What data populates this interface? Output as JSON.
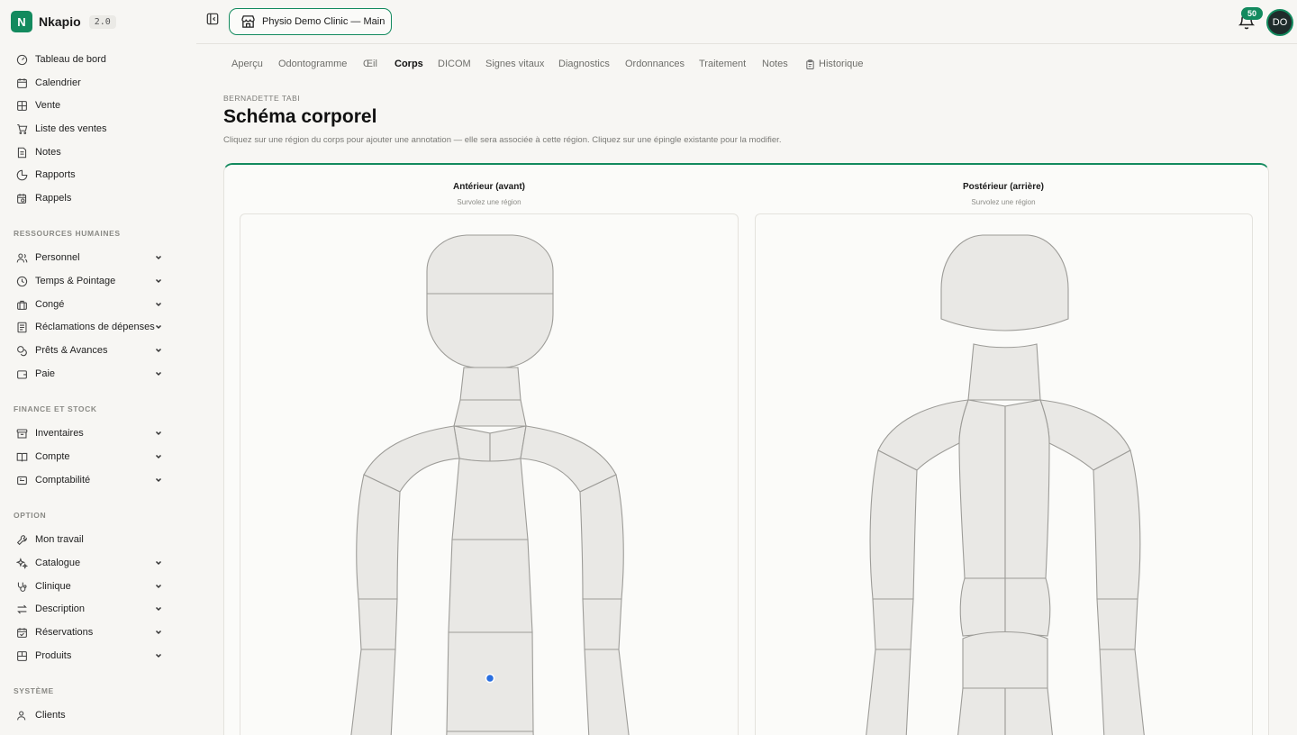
{
  "brand": {
    "logo_letter": "N",
    "name": "Nkapio",
    "version": "2.0"
  },
  "sidebar": {
    "main_items": [
      {
        "label": "Tableau de bord",
        "icon": "dashboard-icon"
      },
      {
        "label": "Calendrier",
        "icon": "calendar-icon"
      },
      {
        "label": "Vente",
        "icon": "grid-icon"
      },
      {
        "label": "Liste des ventes",
        "icon": "cart-icon"
      },
      {
        "label": "Notes",
        "icon": "note-icon"
      },
      {
        "label": "Rapports",
        "icon": "pie-chart-icon"
      },
      {
        "label": "Rappels",
        "icon": "calendar-clock-icon"
      }
    ],
    "sections": [
      {
        "label": "RESSOURCES HUMAINES",
        "items": [
          {
            "label": "Personnel",
            "icon": "users-icon"
          },
          {
            "label": "Temps & Pointage",
            "icon": "clock-icon"
          },
          {
            "label": "Congé",
            "icon": "suitcase-icon"
          },
          {
            "label": "Réclamations de dépenses",
            "icon": "receipt-icon"
          },
          {
            "label": "Prêts & Avances",
            "icon": "coins-icon"
          },
          {
            "label": "Paie",
            "icon": "wallet-icon"
          }
        ]
      },
      {
        "label": "FINANCE ET STOCK",
        "items": [
          {
            "label": "Inventaires",
            "icon": "archive-icon"
          },
          {
            "label": "Compte",
            "icon": "book-icon"
          },
          {
            "label": "Comptabilité",
            "icon": "calculator-icon"
          }
        ]
      },
      {
        "label": "OPTION",
        "items": [
          {
            "label": "Mon travail",
            "icon": "wrench-icon"
          },
          {
            "label": "Catalogue",
            "icon": "sparkles-icon"
          },
          {
            "label": "Clinique",
            "icon": "stethoscope-icon"
          },
          {
            "label": "Description",
            "icon": "arrows-icon"
          },
          {
            "label": "Réservations",
            "icon": "calendar-check-icon"
          },
          {
            "label": "Produits",
            "icon": "box-icon"
          }
        ]
      },
      {
        "label": "SYSTÈME",
        "items": [
          {
            "label": "Clients",
            "icon": "user-icon"
          }
        ]
      }
    ]
  },
  "topbar": {
    "clinic_name": "Physio Demo Clinic — Main",
    "notification_count": "50",
    "avatar_initials": "DO"
  },
  "tabs": [
    {
      "label": "Aperçu",
      "active": false
    },
    {
      "label": "Odontogramme",
      "active": false
    },
    {
      "label": "Œil",
      "active": false
    },
    {
      "label": "Corps",
      "active": true
    },
    {
      "label": "DICOM",
      "active": false
    },
    {
      "label": "Signes vitaux",
      "active": false
    },
    {
      "label": "Diagnostics",
      "active": false
    },
    {
      "label": "Ordonnances",
      "active": false
    },
    {
      "label": "Traitement",
      "active": false
    },
    {
      "label": "Notes",
      "active": false
    },
    {
      "label": "Historique",
      "active": false,
      "icon": "clipboard-icon"
    }
  ],
  "page": {
    "patient_name": "BERNADETTE TABI",
    "title": "Schéma corporel",
    "subtitle": "Cliquez sur une région du corps pour ajouter une annotation — elle sera associée à cette région. Cliquez sur une épingle existante pour la modifier."
  },
  "views": {
    "anterior": {
      "title": "Antérieur (avant)",
      "hint": "Survolez une région"
    },
    "posterior": {
      "title": "Postérieur (arrière)",
      "hint": "Survolez une région"
    }
  },
  "colors": {
    "accent": "#138a5e",
    "pin": "#2a6fe0"
  }
}
